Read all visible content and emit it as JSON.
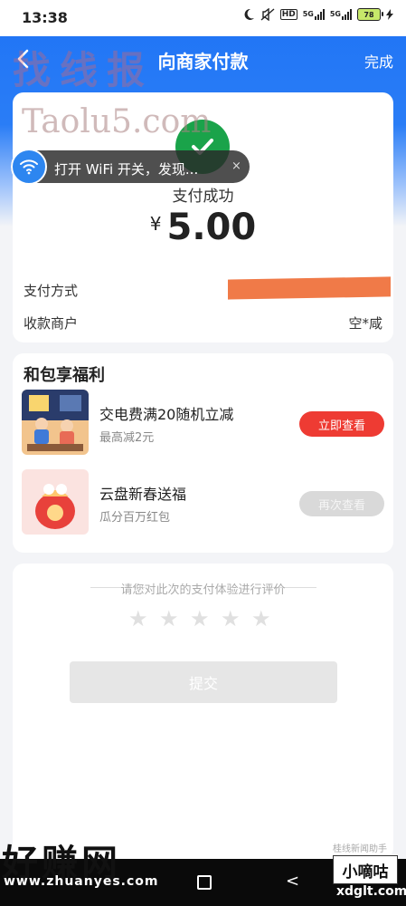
{
  "status_bar": {
    "time": "13:38",
    "hd_label": "HD",
    "signal1_label": "5G",
    "signal2_label": "5G",
    "battery": "78"
  },
  "nav": {
    "title": "向商家付款",
    "done": "完成"
  },
  "payment": {
    "status": "支付成功",
    "currency": "¥",
    "amount": "5.00",
    "method_label": "支付方式",
    "merchant_label": "收款商户",
    "merchant_value": "空*咸"
  },
  "toast": {
    "text": "打开 WiFi 开关，发现...",
    "close": "×"
  },
  "benefits": {
    "title": "和包享福利",
    "items": [
      {
        "title": "交电费满20随机立减",
        "subtitle": "最高减2元",
        "button": "立即查看"
      },
      {
        "title": "云盘新春送福",
        "subtitle": "瓜分百万红包",
        "button": "再次查看"
      }
    ]
  },
  "rating": {
    "prompt": "请您对此次的支付体验进行评价",
    "stars": 5,
    "submit": "提交"
  },
  "watermarks": {
    "top": "找线报",
    "site": "Taolu5.com",
    "bottom": "好赚网",
    "bottom_url": "www.zhuanyes.com",
    "small": "桂线新闻助手",
    "brand": "小嘀咕",
    "brand_url": "xdglt.com"
  },
  "colors": {
    "primary": "#1e73f5",
    "success": "#1aa34a",
    "cta": "#ee3b33"
  }
}
